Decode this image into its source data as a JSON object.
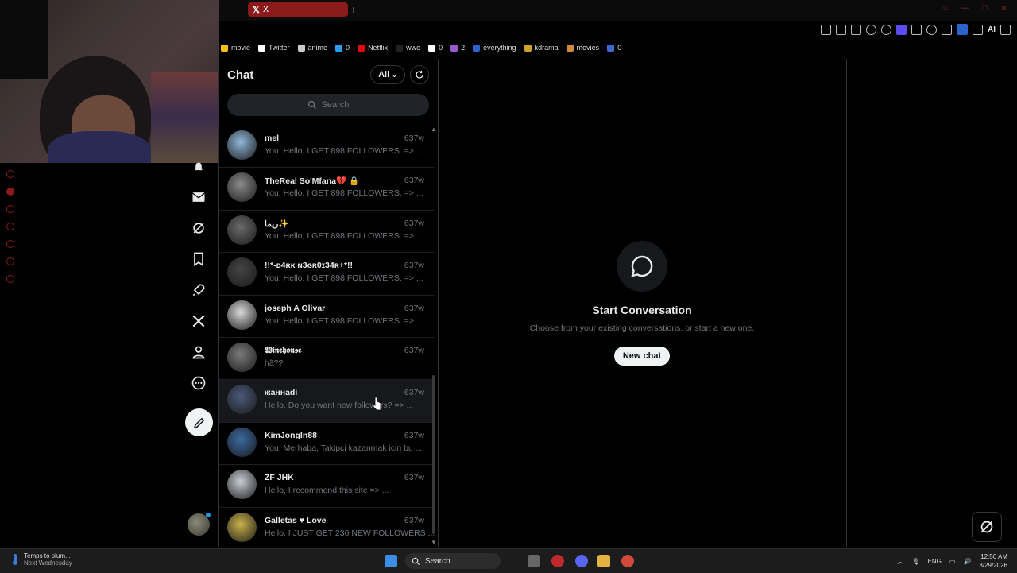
{
  "browser": {
    "tab_title": "X",
    "new_tab": "+",
    "toolbar_ai": "AI",
    "bookmarks": [
      {
        "label": "movie",
        "color": "#f4c20d"
      },
      {
        "label": "Twitter",
        "color": "#ffffff"
      },
      {
        "label": "anime",
        "color": "#cccccc"
      },
      {
        "label": "0",
        "color": "#2a9ef0"
      },
      {
        "label": "Netflix",
        "color": "#e50914"
      },
      {
        "label": "wwe",
        "color": "#222222"
      },
      {
        "label": "0",
        "color": "#ffffff"
      },
      {
        "label": "2",
        "color": "#9b59d0"
      },
      {
        "label": "everything",
        "color": "#2a63c9"
      },
      {
        "label": "kdrama",
        "color": "#c9a227"
      },
      {
        "label": "movies",
        "color": "#d08a3a"
      },
      {
        "label": "0",
        "color": "#3a6ad0"
      }
    ]
  },
  "chat": {
    "title": "Chat",
    "filter": "All",
    "search_placeholder": "Search",
    "conversations": [
      {
        "name": "mel",
        "time": "637w",
        "preview": "You: Hello, I GET 898 FOLLOWERS. => ...",
        "avatar": "#8fb7d9"
      },
      {
        "name": "TheReal So'Mfana💔 🔒",
        "time": "637w",
        "preview": "You: Hello, I GET 898 FOLLOWERS. => ...",
        "avatar": "#8a8a8a"
      },
      {
        "name": "ريما✨",
        "time": "637w",
        "preview": "You: Hello, I GET 898 FOLLOWERS. => ...",
        "avatar": "#6a6a6a"
      },
      {
        "name": "!!*-ᴅ4ʀᴋ ɴ3ɢʀ0ɪ34ʀ+*!!",
        "time": "637w",
        "preview": "You: Hello, I GET 898 FOLLOWERS. => ...",
        "avatar": "#444444"
      },
      {
        "name": "joseph A Olivar",
        "time": "637w",
        "preview": "You: Hello, I GET 898 FOLLOWERS. => ...",
        "avatar": "#d9d9d9"
      },
      {
        "name": "𝖂𝖎𝖓𝖊𝖍𝖔𝖚𝖘𝖊",
        "time": "637w",
        "preview": "hã??",
        "avatar": "#7a7a7a"
      },
      {
        "name": "жаннаdi",
        "time": "637w",
        "preview": "Hello, Do you want new followers? => ...",
        "avatar": "#4a5a7a"
      },
      {
        "name": "KimJongIn88",
        "time": "637w",
        "preview": "You: Merhaba, Takipci kazanmak icin bu ...",
        "avatar": "#3a6aa0"
      },
      {
        "name": "ZF JHK",
        "time": "637w",
        "preview": "Hello, I recommend this site => ...",
        "avatar": "#c9ced6"
      },
      {
        "name": "Galletas ♥ Love",
        "time": "637w",
        "preview": "Hello, I JUST GET 236 NEW FOLLOWERS ...",
        "avatar": "#c9b24a"
      }
    ]
  },
  "empty_state": {
    "title": "Start Conversation",
    "subtitle": "Choose from your existing conversations, or start a new one.",
    "button": "New chat"
  },
  "taskbar": {
    "weather_title": "Temps to plum...",
    "weather_sub": "Next Wednesday",
    "search": "Search",
    "language": "ENG",
    "time": "12:56 AM",
    "date": "3/29/2026"
  }
}
